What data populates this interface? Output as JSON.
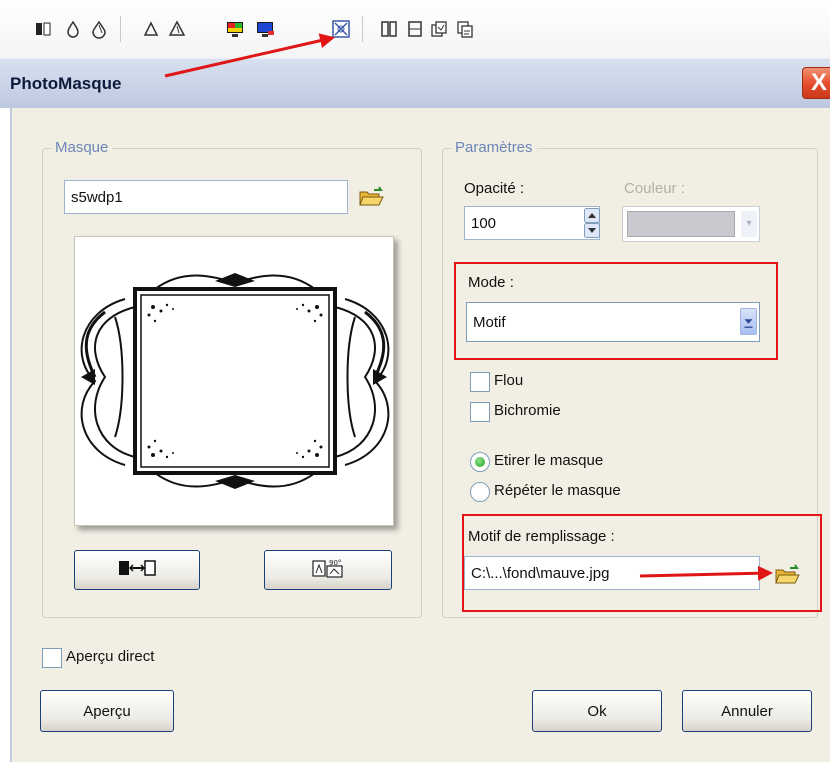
{
  "window": {
    "title": "PhotoMasque",
    "close_label": "X"
  },
  "masque": {
    "group_label": "Masque",
    "name_value": "s5wdp1"
  },
  "parametres": {
    "group_label": "Paramètres",
    "opacity_label": "Opacité :",
    "opacity_value": "100",
    "color_label": "Couleur :",
    "mode_label": "Mode :",
    "mode_value": "Motif",
    "flou_label": "Flou",
    "bichromie_label": "Bichromie",
    "stretch_label": "Etirer le masque",
    "repeat_label": "Répéter le masque",
    "fill_label": "Motif de remplissage :",
    "fill_value": "C:\\...\\fond\\mauve.jpg"
  },
  "footer": {
    "live_preview_label": "Aperçu direct",
    "preview_button": "Aperçu",
    "ok_button": "Ok",
    "cancel_button": "Annuler"
  },
  "toolbar": {
    "icons": [
      "flip-icon",
      "drop-icon",
      "drop-outline-icon",
      "triangle-drop-icon",
      "triangle-drop-outline-icon",
      "color-monitor-icon",
      "monitor-icon",
      "photomask-icon",
      "book-icon",
      "page-icon",
      "layers-icon",
      "copy-layers-icon"
    ]
  },
  "colors": {
    "accent_red": "#e01515",
    "dialog_bg": "#f1efe4",
    "group_label": "#6d86b8"
  }
}
